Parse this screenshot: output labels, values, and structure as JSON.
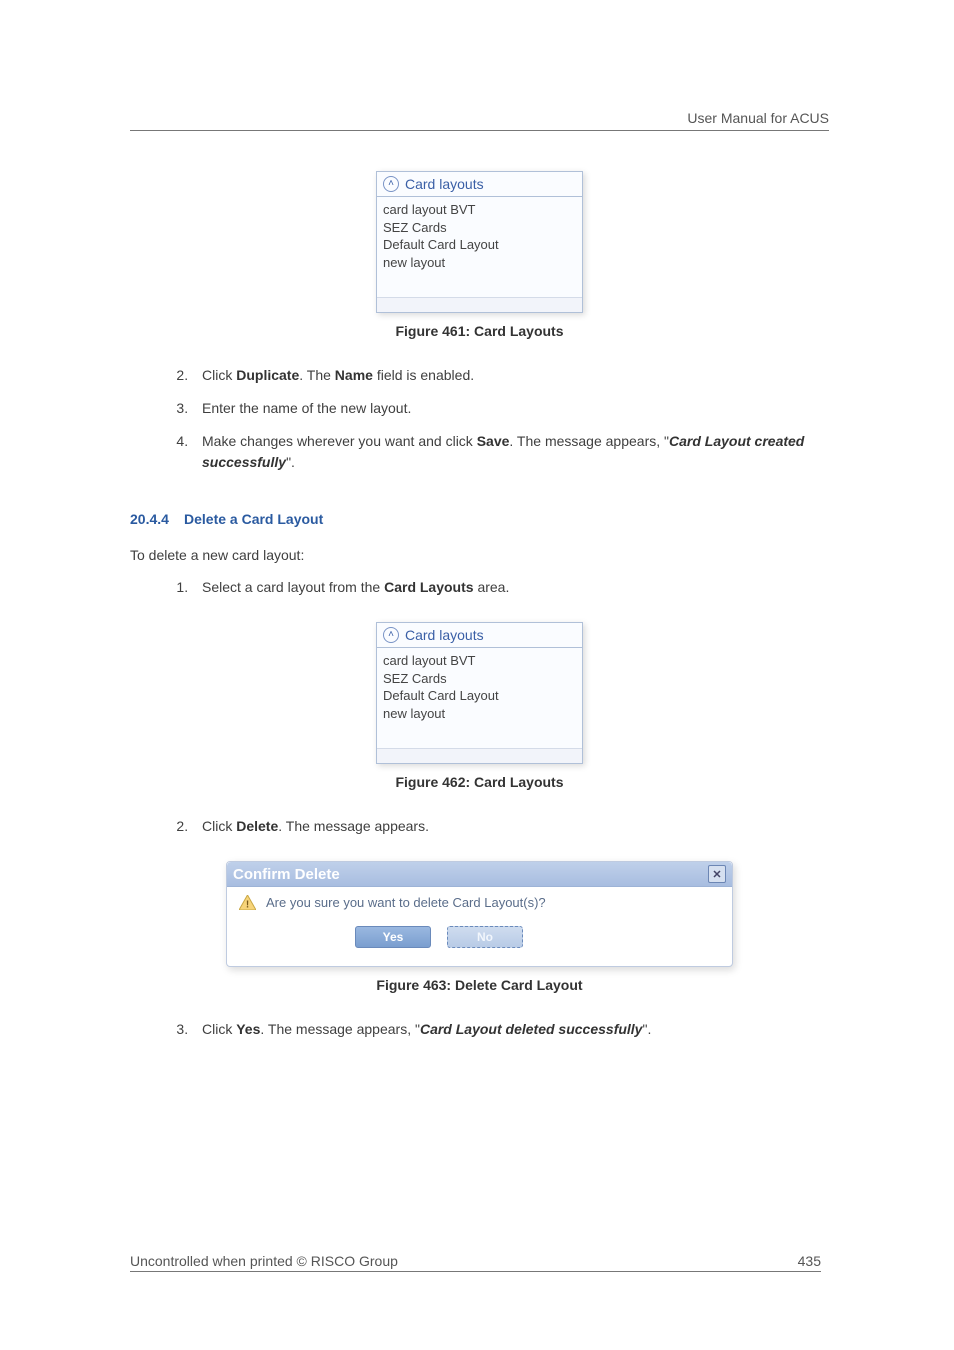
{
  "header": {
    "right_text": "User Manual for ACUS"
  },
  "panel1": {
    "title": "Card layouts",
    "items": [
      "card layout BVT",
      "SEZ Cards",
      "Default Card Layout",
      "new layout"
    ]
  },
  "caption1": "Figure 461: Card Layouts",
  "steps_a": {
    "start": 2,
    "items": [
      {
        "pre": "Click ",
        "b1": "Duplicate",
        "mid": ". The ",
        "b2": "Name",
        "post": " field is enabled."
      },
      {
        "pre": "Enter the name of the new layout.",
        "b1": "",
        "mid": "",
        "b2": "",
        "post": ""
      },
      {
        "pre": "Make changes wherever you want and click ",
        "b1": "Save",
        "mid": ". The message appears, \"",
        "b2": "",
        "bi": "Card Layout created successfully",
        "post": "\"."
      }
    ]
  },
  "section": {
    "number": "20.4.4",
    "title": "Delete a Card Layout"
  },
  "intro": "To delete a new card layout:",
  "steps_b1": {
    "start": 1,
    "item": {
      "pre": "Select a card layout from the ",
      "b1": "Card Layouts",
      "post": " area."
    }
  },
  "panel2": {
    "title": "Card layouts",
    "items": [
      "card layout BVT",
      "SEZ Cards",
      "Default Card Layout",
      "new layout"
    ]
  },
  "caption2": "Figure 462: Card Layouts",
  "steps_b2": {
    "start": 2,
    "item": {
      "pre": "Click ",
      "b1": "Delete",
      "post": ". The message appears."
    }
  },
  "dialog": {
    "title": "Confirm Delete",
    "message": "Are you sure you want to delete Card Layout(s)?",
    "yes": "Yes",
    "no": "No"
  },
  "caption3": "Figure 463: Delete Card Layout",
  "steps_b3": {
    "start": 3,
    "item": {
      "pre": "Click ",
      "b1": "Yes",
      "mid": ". The message appears, \"",
      "bi": "Card Layout deleted successfully",
      "post": "\"."
    }
  },
  "footer": {
    "left": "Uncontrolled when printed © RISCO Group",
    "right": "435"
  }
}
